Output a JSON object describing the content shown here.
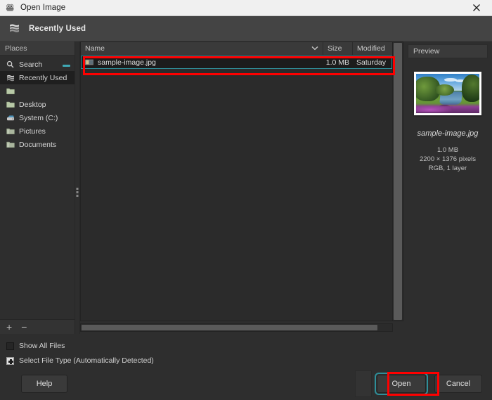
{
  "window": {
    "title": "Open Image",
    "icon": "gimp-wilber-icon",
    "close_label": "×"
  },
  "location": {
    "label": "Recently Used",
    "icon": "recently-used-icon"
  },
  "places": {
    "header": "Places",
    "items": [
      {
        "label": "Search",
        "icon": "search-icon",
        "selected": false,
        "marker": true
      },
      {
        "label": "Recently Used",
        "icon": "recently-used-icon",
        "selected": true,
        "marker": false
      },
      {
        "label": "",
        "icon": "folder-icon",
        "selected": false,
        "marker": false
      },
      {
        "label": "Desktop",
        "icon": "folder-icon",
        "selected": false,
        "marker": false
      },
      {
        "label": "System (C:)",
        "icon": "drive-icon",
        "selected": false,
        "marker": false
      },
      {
        "label": "Pictures",
        "icon": "folder-dark-icon",
        "selected": false,
        "marker": false
      },
      {
        "label": "Documents",
        "icon": "folder-dark-icon",
        "selected": false,
        "marker": false
      }
    ],
    "add_label": "+",
    "remove_label": "−"
  },
  "file_list": {
    "columns": [
      "Name",
      "Size",
      "Modified"
    ],
    "sort_column": "Name",
    "sort_icon": "chevron-down-icon",
    "rows": [
      {
        "name": "sample-image.jpg",
        "size": "1.0 MB",
        "modified": "Saturday",
        "icon": "image-file-icon",
        "selected": true
      }
    ]
  },
  "preview": {
    "header": "Preview",
    "filename": "sample-image.jpg",
    "filesize": "1.0 MB",
    "dimensions": "2200 × 1376 pixels",
    "colormode": "RGB,  1 layer"
  },
  "options": {
    "show_all_files_label": "Show All Files",
    "show_all_files_checked": false,
    "file_type_label": "Select File Type (Automatically Detected)",
    "file_type_expanded": false
  },
  "buttons": {
    "help": "Help",
    "open": "Open",
    "cancel": "Cancel"
  },
  "annotations": {
    "accent_color": "#fe0000",
    "focus_color": "#2f8f99",
    "highlighted": [
      "file-row-sample-image",
      "open-button"
    ]
  }
}
